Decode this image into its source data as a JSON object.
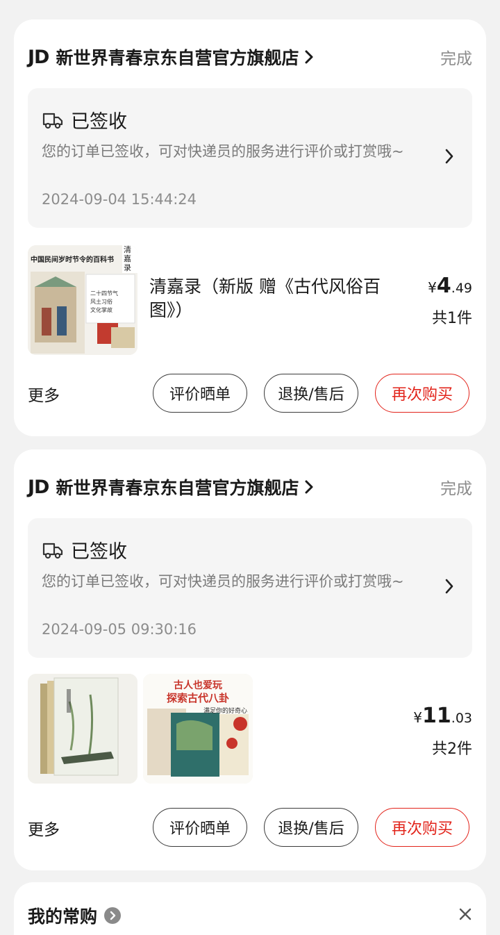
{
  "orders": [
    {
      "shop_logo": "JD",
      "shop_name": "新世界青春京东自营官方旗舰店",
      "state": "完成",
      "status_title": "已签收",
      "status_desc": "您的订单已签收，可对快递员的服务进行评价或打赏哦~",
      "status_time": "2024-09-04 15:44:24",
      "product_title": "清嘉录（新版 赠《古代风俗百图》）",
      "price_symbol": "¥",
      "price_int": "4",
      "price_dec": ".49",
      "count": "共1件",
      "more": "更多",
      "btn_review": "评价晒单",
      "btn_return": "退换/售后",
      "btn_rebuy": "再次购买",
      "cover_text": {
        "headline": "中国民间岁时节令的百科书",
        "spine": "清嘉录",
        "sub1": "二十四节气",
        "sub2": "风土习俗",
        "sub3": "文化掌故"
      }
    },
    {
      "shop_logo": "JD",
      "shop_name": "新世界青春京东自营官方旗舰店",
      "state": "完成",
      "status_title": "已签收",
      "status_desc": "您的订单已签收，可对快递员的服务进行评价或打赏哦~",
      "status_time": "2024-09-05 09:30:16",
      "price_symbol": "¥",
      "price_int": "11",
      "price_dec": ".03",
      "count": "共2件",
      "more": "更多",
      "btn_review": "评价晒单",
      "btn_return": "退换/售后",
      "btn_rebuy": "再次购买",
      "cover2_text": {
        "line1": "古人也爱玩",
        "line2": "探索古代八卦",
        "line3": "满足你的好奇心"
      }
    }
  ],
  "favorites": {
    "title": "我的常购"
  },
  "colors": {
    "accent_red": "#e2231a",
    "card_bg": "#ffffff",
    "page_bg": "#f2f2f2",
    "status_bg": "#f5f5f5"
  },
  "icons": {
    "truck": "truck-icon",
    "chevron": "chevron-right-icon",
    "info": "info-icon",
    "close": "close-icon"
  }
}
